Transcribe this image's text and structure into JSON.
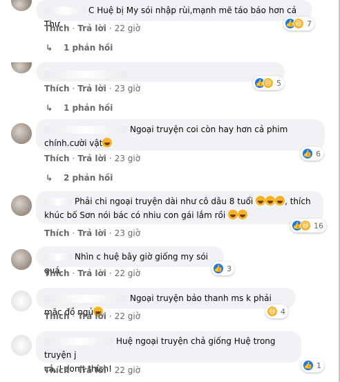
{
  "labels": {
    "like": "Thích",
    "reply": "Trả lời",
    "dot": "·"
  },
  "colors": {
    "meta": "#65676b",
    "bubble": "#f0f2f5",
    "like": "#1877f2",
    "haha": "#f7b125"
  },
  "comments": [
    {
      "text": "C Huệ bị My sói nhập rùi,mạnh mẽ táo báo hơn cả Thư.",
      "time": "22 giờ",
      "reactions": [
        "like-icon",
        "haha-icon"
      ],
      "count": "7",
      "replies": "1 phản hồi"
    },
    {
      "text": "",
      "time": "23 giờ",
      "reactions": [
        "like-icon",
        "sad-icon"
      ],
      "count": "5",
      "replies": "1 phản hồi"
    },
    {
      "text_line1": "Ngoại truyện coi còn hay hơn cả phim",
      "text_line2": "chính.cười vật",
      "time": "23 giờ",
      "reactions": [
        "like-icon"
      ],
      "count": "6",
      "replies": "2 phản hồi"
    },
    {
      "text_line1": "Phải chi ngoại truyện dài như cô dâu 8 tuổi",
      "text_line1b": ", thích",
      "text_line2": "khúc bố Sơn nói bác có nhiu con gái lắm rồi",
      "time": "23 giờ",
      "reactions": [
        "like-icon",
        "haha-icon"
      ],
      "count": "16"
    },
    {
      "text": "Nhìn c huệ bây giờ giống my sói quá",
      "time": "22 giờ",
      "reactions": [
        "like-icon"
      ],
      "count": "3"
    },
    {
      "text": "Ngoại truyện bảo thanh ms k phải mặc đồ ngủ",
      "time": "22 giờ",
      "reactions": [
        "haha-icon"
      ],
      "count": "4"
    },
    {
      "text_line1": "Huệ ngoại truyện chả giống Huệ trong truyện j",
      "text_line2": "cả, I don't thích!",
      "time": "22 giờ",
      "reactions": [
        "like-icon"
      ],
      "count": "1"
    }
  ]
}
